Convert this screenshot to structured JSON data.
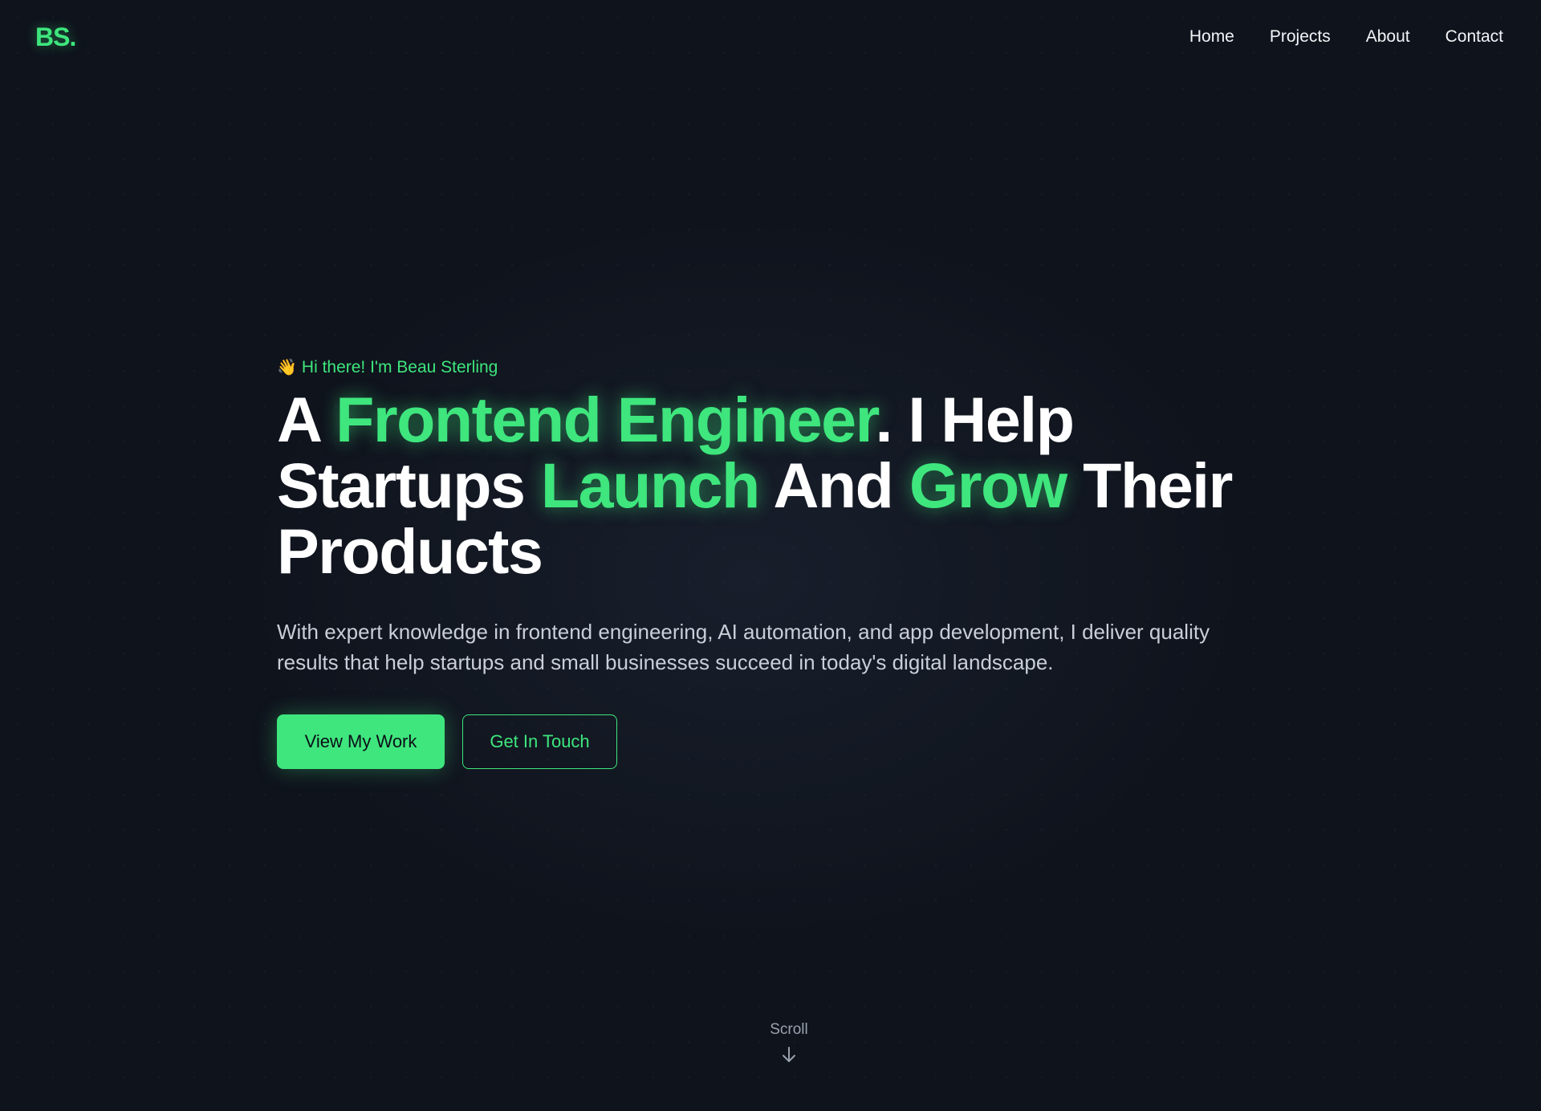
{
  "header": {
    "logo": "BS.",
    "nav": [
      {
        "label": "Home"
      },
      {
        "label": "Projects"
      },
      {
        "label": "About"
      },
      {
        "label": "Contact"
      }
    ]
  },
  "hero": {
    "greeting_icon": "👋",
    "greeting": "Hi there! I'm Beau Sterling",
    "headline": {
      "w1": "A ",
      "accent1": "Frontend Engineer",
      "w2": ". I Help Startups ",
      "accent2": "Launch",
      "w3": " And ",
      "accent3": "Grow",
      "w4": " Their Products"
    },
    "description": "With expert knowledge in frontend engineering, AI automation, and app development, I deliver quality results that help startups and small businesses succeed in today's digital landscape.",
    "primary_button": "View My Work",
    "secondary_button": "Get In Touch"
  },
  "scroll": {
    "label": "Scroll",
    "icon": "arrow-down-icon"
  },
  "colors": {
    "background": "#0f131c",
    "accent": "#3ee67d",
    "text": "#ffffff",
    "muted": "#c9ced8"
  }
}
